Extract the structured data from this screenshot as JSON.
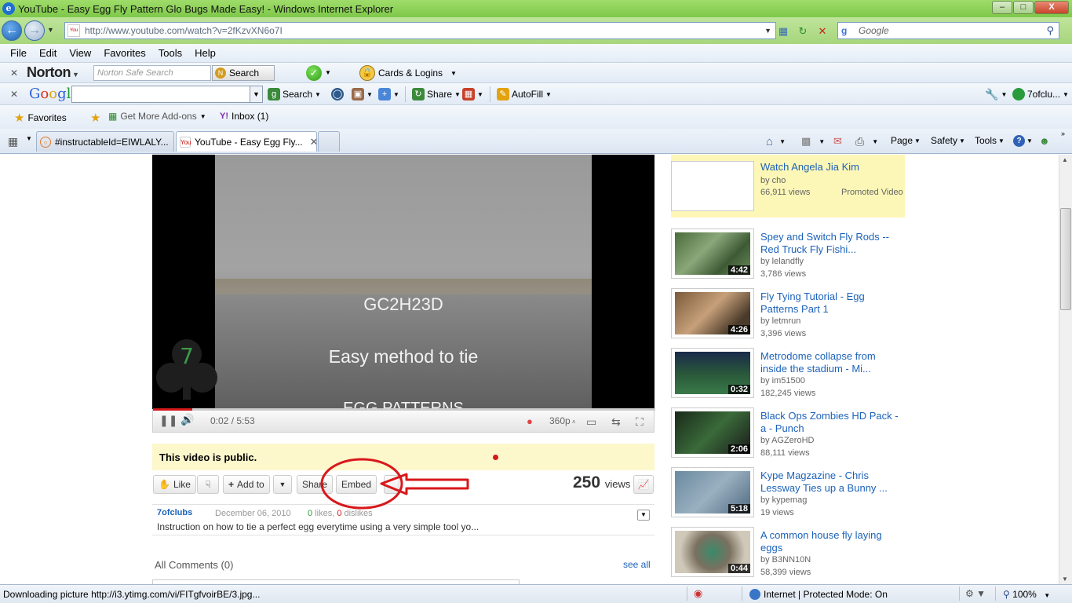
{
  "window": {
    "title": "YouTube - Easy Egg Fly Pattern Glo Bugs Made Easy! - Windows Internet Explorer",
    "minimize": "–",
    "maximize": "□",
    "close": "X"
  },
  "address": {
    "url": "http://www.youtube.com/watch?v=2fKzvXN6o7I",
    "search_placeholder": "Google"
  },
  "menu": [
    "File",
    "Edit",
    "View",
    "Favorites",
    "Tools",
    "Help"
  ],
  "norton": {
    "logo": "Norton",
    "search_placeholder": "Norton Safe Search",
    "search_label": "Search",
    "cards_label": "Cards & Logins"
  },
  "google_toolbar": {
    "search_label": "Search",
    "share_label": "Share",
    "autofill_label": "AutoFill",
    "user_label": "7ofclu..."
  },
  "favorites_bar": {
    "favorites_label": "Favorites",
    "addons_label": "Get More Add-ons",
    "inbox_label": "Inbox (1)"
  },
  "tabs": [
    {
      "label": "#instructableId=EIWLALY...",
      "active": false
    },
    {
      "label": "YouTube - Easy Egg Fly...",
      "active": true
    }
  ],
  "command_bar": {
    "page": "Page",
    "safety": "Safety",
    "tools": "Tools"
  },
  "video": {
    "caption1": "GC2H23D",
    "caption2": "Easy method to tie",
    "caption3": "EGG PATTERNS",
    "logo_digit": "7",
    "time": "0:02 / 5:53",
    "quality": "360p",
    "progress_fraction": 0.006
  },
  "public_notice": "This video is public.",
  "actions": {
    "like": "Like",
    "add_to": "Add to",
    "share": "Share",
    "embed": "Embed",
    "views_count": "250",
    "views_label": "views"
  },
  "description": {
    "user": "7ofclubs",
    "date": "December 06, 2010",
    "likes_count": "0",
    "likes_label": "likes,",
    "dislikes_count": "0",
    "dislikes_label": "dislikes",
    "text": "Instruction on how to tie a perfect egg everytime using a very simple tool yo..."
  },
  "comments": {
    "heading": "All Comments (0)",
    "see_all": "see all"
  },
  "promoted": {
    "title": "Watch Angela Jia Kim",
    "by": "by cho",
    "views": "66,911 views",
    "label": "Promoted Video"
  },
  "related": [
    {
      "title": "Spey and Switch Fly Rods -- Red Truck Fly Fishi...",
      "by": "by lelandfly",
      "views": "3,786 views",
      "duration": "4:42"
    },
    {
      "title": "Fly Tying Tutorial - Egg Patterns Part 1",
      "by": "by letmrun",
      "views": "3,396 views",
      "duration": "4:26"
    },
    {
      "title": "Metrodome collapse from inside the stadium - Mi...",
      "by": "by im51500",
      "views": "182,245 views",
      "duration": "0:32"
    },
    {
      "title": "Black Ops Zombies HD Pack - a - Punch",
      "by": "by AGZeroHD",
      "views": "88,111 views",
      "duration": "2:06"
    },
    {
      "title": "Kype Magzazine - Chris Lessway Ties up a Bunny ...",
      "by": "by kypemag",
      "views": "19 views",
      "duration": "5:18"
    },
    {
      "title": "A common house fly laying eggs",
      "by": "by B3NN10N",
      "views": "58,399 views",
      "duration": "0:44"
    }
  ],
  "status": {
    "text": "Downloading picture http://i3.ytimg.com/vi/FITgfvoirBE/3.jpg...",
    "zone": "Internet | Protected Mode: On",
    "zoom": "100%"
  },
  "colors": {
    "titlebar": "#7ec84a",
    "link": "#1c62b9",
    "promo_bg": "#fdf7b7",
    "public_bg": "#fdf7cc",
    "annotation": "#d8181b"
  }
}
